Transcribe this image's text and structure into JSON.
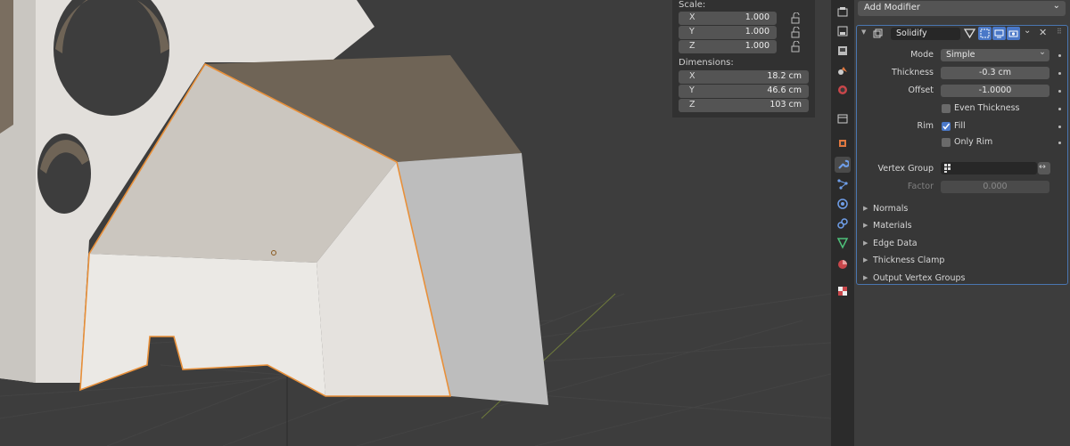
{
  "npanel": {
    "scale_label": "Scale:",
    "scale": [
      {
        "axis": "X",
        "value": "1.000"
      },
      {
        "axis": "Y",
        "value": "1.000"
      },
      {
        "axis": "Z",
        "value": "1.000"
      }
    ],
    "dimensions_label": "Dimensions:",
    "dimensions": [
      {
        "axis": "X",
        "value": "18.2 cm"
      },
      {
        "axis": "Y",
        "value": "46.6 cm"
      },
      {
        "axis": "Z",
        "value": "103 cm"
      }
    ]
  },
  "tabs": [
    "render-icon",
    "output-icon",
    "view-layer-icon",
    "scene-icon",
    "world-icon",
    "collection-icon",
    "object-icon",
    "modifier-icon",
    "particles-icon",
    "physics-icon",
    "constraints-icon",
    "data-icon",
    "material-icon",
    "texture-icon"
  ],
  "props": {
    "add_modifier": "Add Modifier",
    "modifier_name": "Solidify",
    "rows": {
      "mode_label": "Mode",
      "mode_value": "Simple",
      "thickness_label": "Thickness",
      "thickness_value": "-0.3 cm",
      "offset_label": "Offset",
      "offset_value": "-1.0000",
      "even_thickness": "Even Thickness",
      "rim_label": "Rim",
      "fill": "Fill",
      "only_rim": "Only Rim",
      "vertex_group_label": "Vertex Group",
      "factor_label": "Factor",
      "factor_value": "0.000"
    },
    "subpanels": [
      "Normals",
      "Materials",
      "Edge Data",
      "Thickness Clamp",
      "Output Vertex Groups"
    ]
  },
  "colors": {
    "accent": "#4a78c8",
    "selection_outline": "#e8903a",
    "background": "#3d3d3d"
  }
}
